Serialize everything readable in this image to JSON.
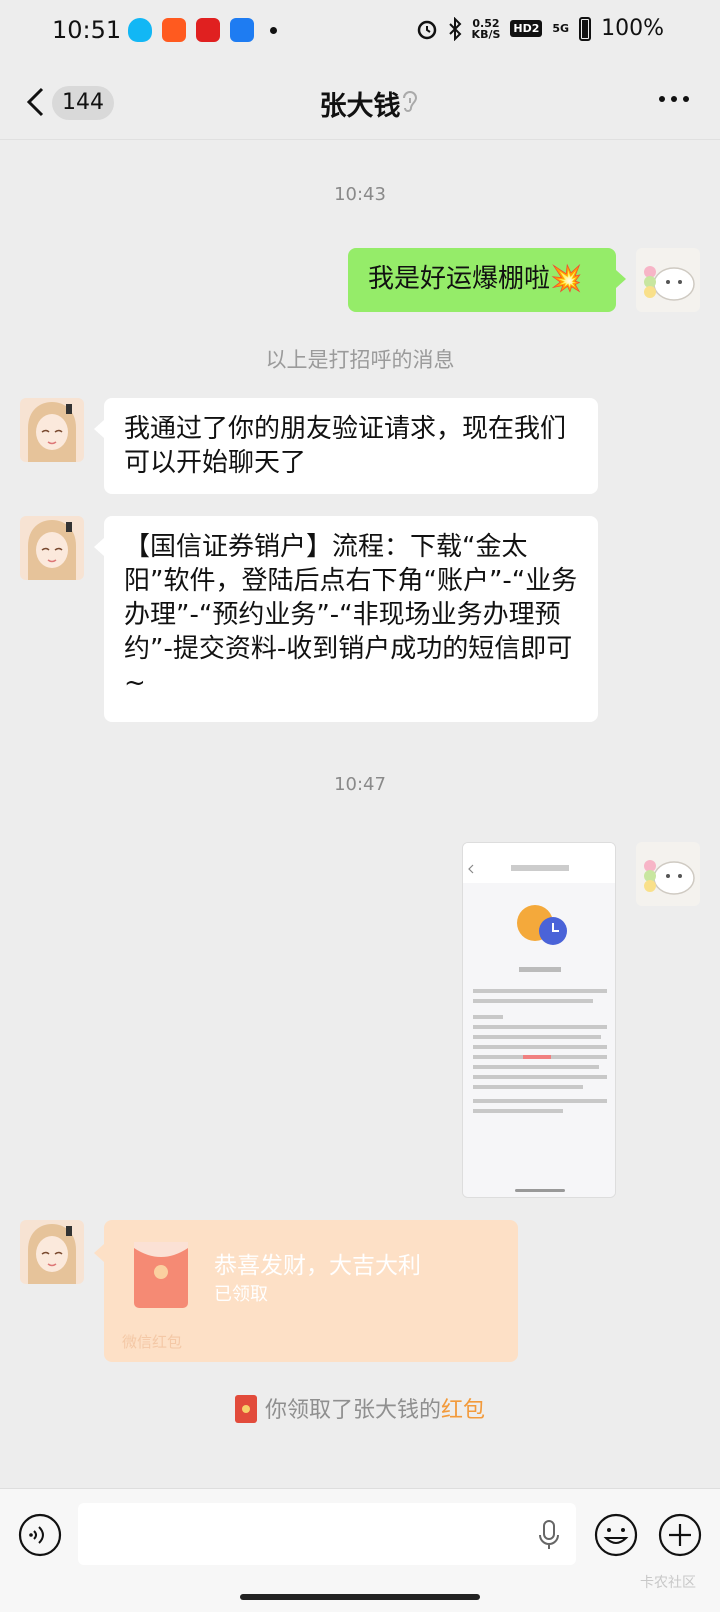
{
  "status_bar": {
    "time": "10:51",
    "net_speed_value": "0.52",
    "net_speed_unit": "KB/S",
    "hd_label": "HD2",
    "signal_label": "5G",
    "battery": "100%"
  },
  "nav": {
    "unread_count": "144",
    "title": "张大钱"
  },
  "chat": {
    "timestamp_1": "10:43",
    "msg_self_1": "我是好运爆棚啦💥",
    "system_greeting": "以上是打招呼的消息",
    "msg_friend_1": "我通过了你的朋友验证请求，现在我们可以开始聊天了",
    "msg_friend_2": "【国信证券销户】流程：下载“金太阳”软件，登陆后点右下角“账户”-“业务办理”-“预约业务”-“非现场业务办理预约”-提交资料-收到销户成功的短信即可~",
    "timestamp_2": "10:47",
    "red_packet": {
      "title": "恭喜发财，大吉大利",
      "status": "已领取",
      "footer": "微信红包"
    },
    "red_packet_note_prefix": "你领取了张大钱的",
    "red_packet_note_link": "红包"
  },
  "watermark": "卡农社区",
  "colors": {
    "self_bubble": "#95ec69",
    "friend_bubble": "#ffffff",
    "background": "#ededed",
    "red_packet_bg": "#fde0c6",
    "link": "#f29a3b"
  }
}
